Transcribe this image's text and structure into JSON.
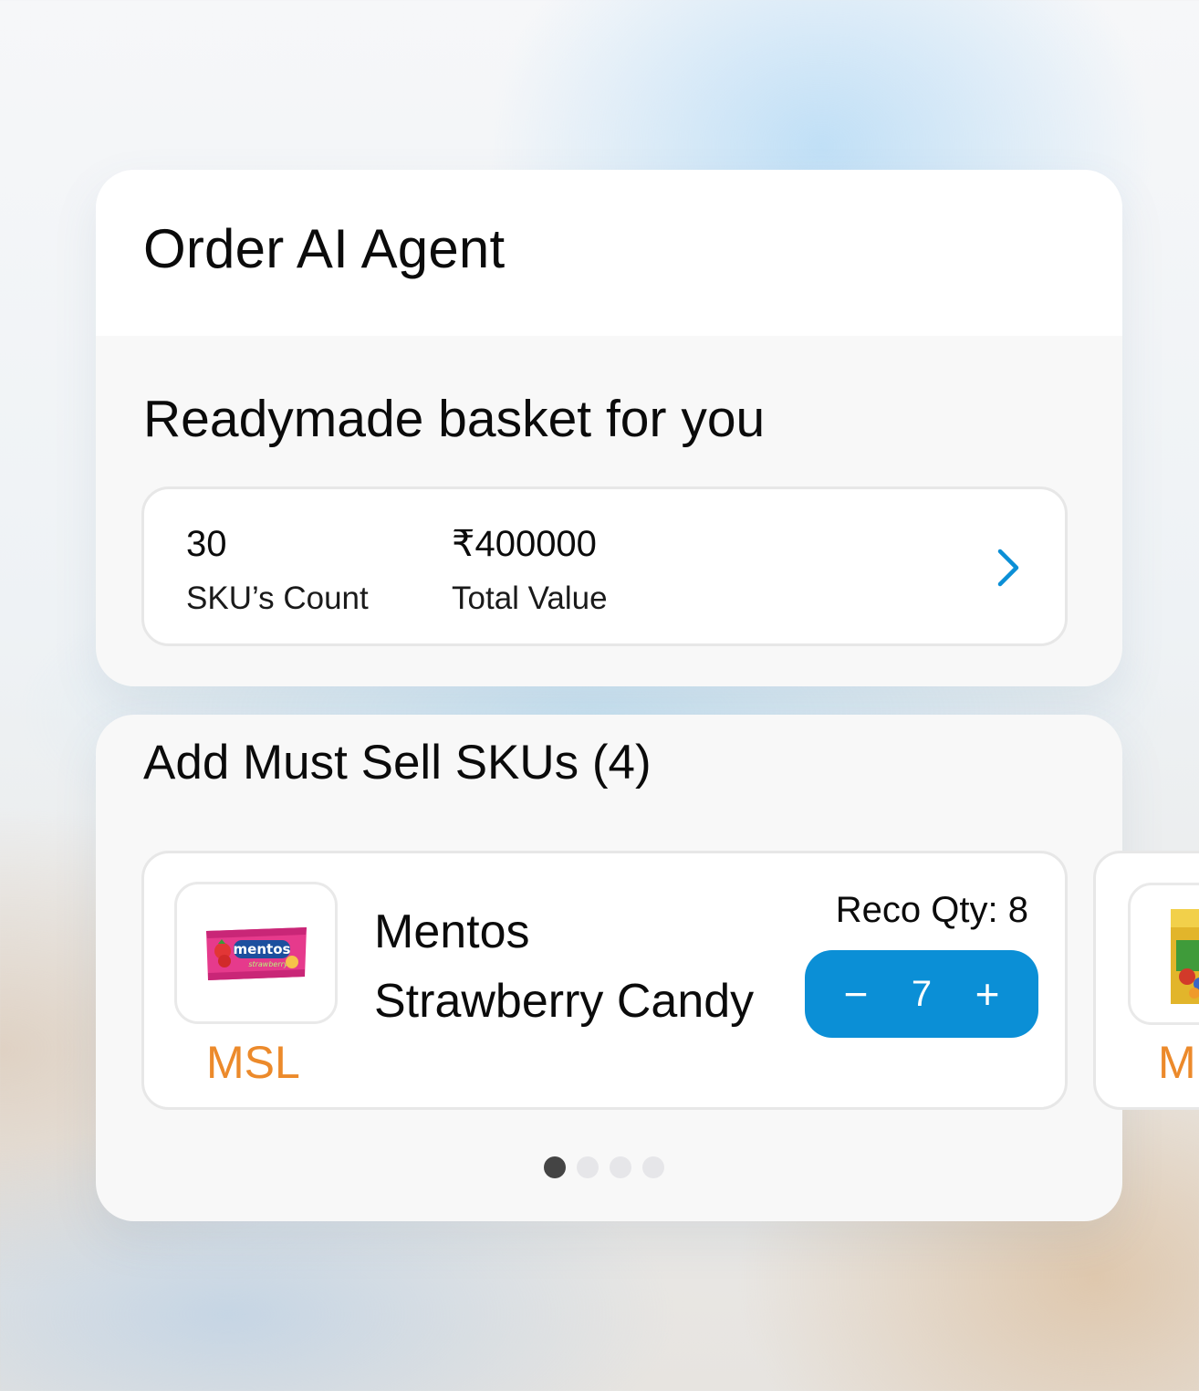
{
  "header": {
    "title": "Order AI Agent"
  },
  "basket": {
    "title": "Readymade basket for you",
    "sku_count_value": "30",
    "sku_count_label": "SKU’s Count",
    "total_value": "₹400000",
    "total_value_label": "Total Value",
    "chevron_icon": "chevron-right-icon"
  },
  "must_sell": {
    "title": "Add Must Sell SKUs (4)",
    "items": [
      {
        "name_line1": "Mentos",
        "name_line2": "Strawberry Candy",
        "badge": "MSL",
        "reco_qty": "Reco Qty: 8",
        "qty": "7",
        "minus_label": "−",
        "plus_label": "+"
      },
      {
        "badge": "M"
      }
    ],
    "pagination": {
      "total": 4,
      "active": 1
    }
  },
  "colors": {
    "accent_blue": "#0b8fd6",
    "msl_orange": "#ec8a2b",
    "dot_active": "#444444",
    "dot_inactive": "#e6e6e9"
  }
}
